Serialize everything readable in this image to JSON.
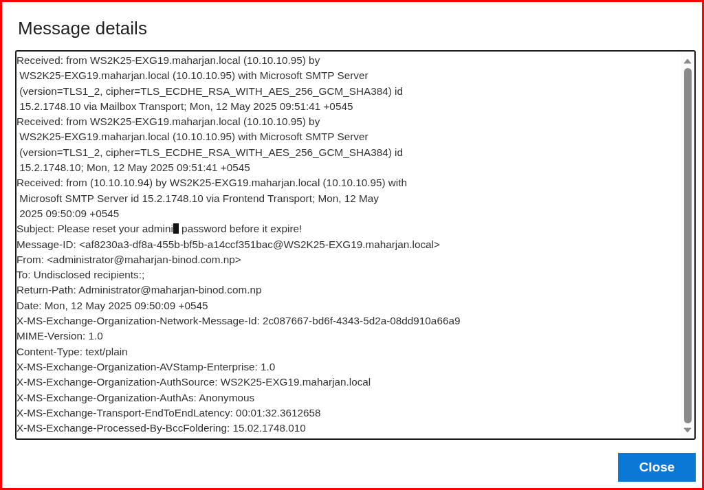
{
  "dialog": {
    "title": "Message details",
    "header_lines": [
      {
        "kind": "plain",
        "text": "Received: from WS2K25-EXG19.maharjan.local (10.10.10.95) by"
      },
      {
        "kind": "plain",
        "text": " WS2K25-EXG19.maharjan.local (10.10.10.95) with Microsoft SMTP Server"
      },
      {
        "kind": "plain",
        "text": " (version=TLS1_2, cipher=TLS_ECDHE_RSA_WITH_AES_256_GCM_SHA384) id"
      },
      {
        "kind": "plain",
        "text": " 15.2.1748.10 via Mailbox Transport; Mon, 12 May 2025 09:51:41 +0545"
      },
      {
        "kind": "plain",
        "text": "Received: from WS2K25-EXG19.maharjan.local (10.10.10.95) by"
      },
      {
        "kind": "plain",
        "text": " WS2K25-EXG19.maharjan.local (10.10.10.95) with Microsoft SMTP Server"
      },
      {
        "kind": "plain",
        "text": " (version=TLS1_2, cipher=TLS_ECDHE_RSA_WITH_AES_256_GCM_SHA384) id"
      },
      {
        "kind": "plain",
        "text": " 15.2.1748.10; Mon, 12 May 2025 09:51:41 +0545"
      },
      {
        "kind": "plain",
        "text": "Received: from (10.10.10.94) by WS2K25-EXG19.maharjan.local (10.10.10.95) with"
      },
      {
        "kind": "plain",
        "text": " Microsoft SMTP Server id 15.2.1748.10 via Frontend Transport; Mon, 12 May"
      },
      {
        "kind": "plain",
        "text": " 2025 09:50:09 +0545"
      },
      {
        "kind": "redacted",
        "before": "Subject: Please reset your admini",
        "after": " password before it expire!"
      },
      {
        "kind": "plain",
        "text": "Message-ID: <af8230a3-df8a-455b-bf5b-a14ccf351bac@WS2K25-EXG19.maharjan.local>"
      },
      {
        "kind": "plain",
        "text": "From: <administrator@maharjan-binod.com.np>"
      },
      {
        "kind": "plain",
        "text": "To: Undisclosed recipients:;"
      },
      {
        "kind": "plain",
        "text": "Return-Path: Administrator@maharjan-binod.com.np"
      },
      {
        "kind": "plain",
        "text": "Date: Mon, 12 May 2025 09:50:09 +0545"
      },
      {
        "kind": "plain",
        "text": "X-MS-Exchange-Organization-Network-Message-Id: 2c087667-bd6f-4343-5d2a-08dd910a66a9"
      },
      {
        "kind": "plain",
        "text": "MIME-Version: 1.0"
      },
      {
        "kind": "plain",
        "text": "Content-Type: text/plain"
      },
      {
        "kind": "plain",
        "text": "X-MS-Exchange-Organization-AVStamp-Enterprise: 1.0"
      },
      {
        "kind": "plain",
        "text": "X-MS-Exchange-Organization-AuthSource: WS2K25-EXG19.maharjan.local"
      },
      {
        "kind": "plain",
        "text": "X-MS-Exchange-Organization-AuthAs: Anonymous"
      },
      {
        "kind": "plain",
        "text": "X-MS-Exchange-Transport-EndToEndLatency: 00:01:32.3612658"
      },
      {
        "kind": "plain",
        "text": "X-MS-Exchange-Processed-By-BccFoldering: 15.02.1748.010"
      }
    ],
    "buttons": [
      {
        "label": "Close"
      }
    ]
  }
}
